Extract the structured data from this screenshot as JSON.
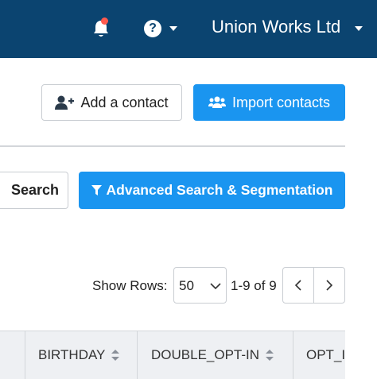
{
  "header": {
    "org_name": "Union Works Ltd",
    "icons": [
      "bell-icon",
      "help-icon",
      "chevron-down-icon"
    ]
  },
  "actions": {
    "add_contact_label": "Add a contact",
    "import_contacts_label": "Import contacts"
  },
  "search": {
    "search_label": "Search",
    "advanced_label": "Advanced Search & Segmentation"
  },
  "pagination": {
    "show_rows_label": "Show Rows:",
    "rows_per_page": "50",
    "range_text": "1-9 of 9"
  },
  "table": {
    "columns": [
      "BIRTHDAY",
      "DOUBLE_OPT-IN",
      "OPT_I"
    ]
  },
  "colors": {
    "topbar": "#0b4470",
    "primary": "#1a95f0",
    "notification_dot": "#ff5a4e"
  }
}
